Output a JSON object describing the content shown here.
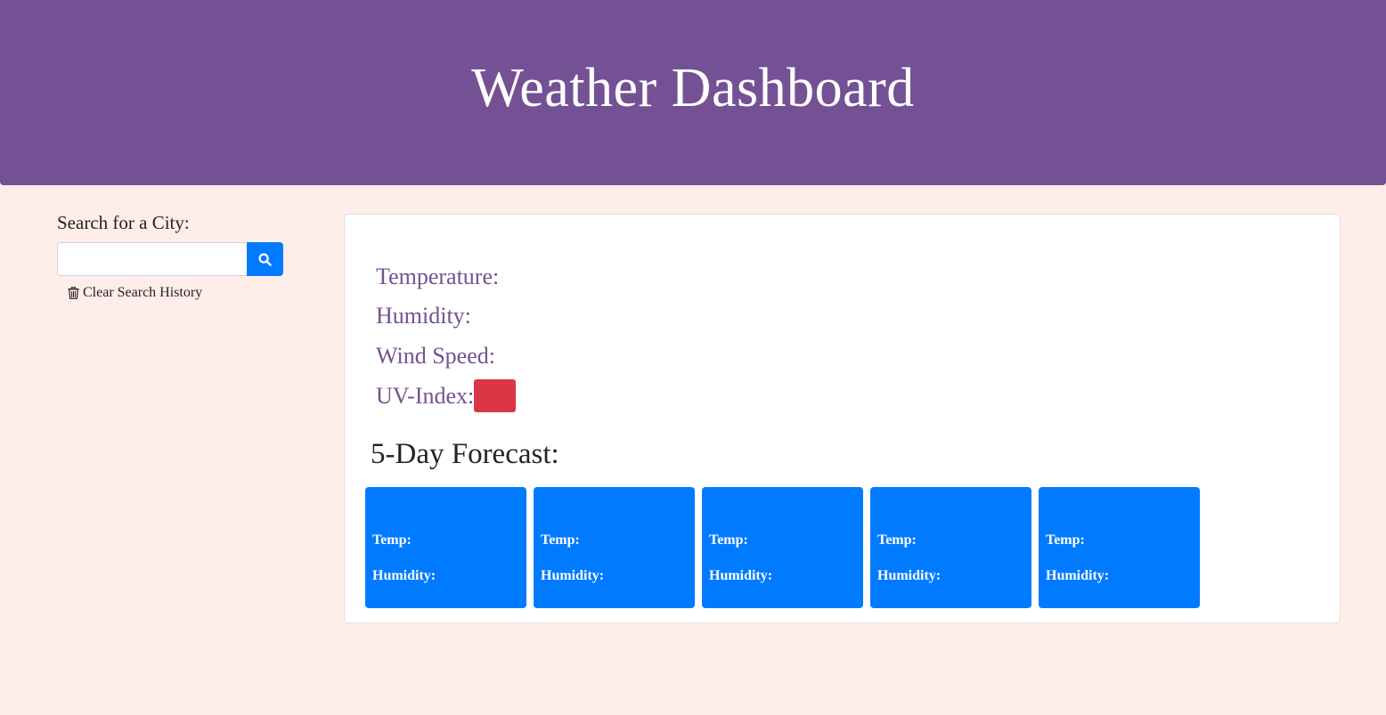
{
  "header": {
    "title": "Weather Dashboard"
  },
  "search": {
    "label": "Search for a City:",
    "value": "",
    "placeholder": "",
    "clear_label": "Clear Search History"
  },
  "current": {
    "temperature_label": "Temperature:",
    "humidity_label": "Humidity:",
    "wind_label": "Wind Speed:",
    "uv_label": "UV-Index:",
    "uv_color": "#dc3545"
  },
  "forecast": {
    "title": "5-Day Forecast:",
    "days": [
      {
        "temp_label": "Temp:",
        "humidity_label": "Humidity:"
      },
      {
        "temp_label": "Temp:",
        "humidity_label": "Humidity:"
      },
      {
        "temp_label": "Temp:",
        "humidity_label": "Humidity:"
      },
      {
        "temp_label": "Temp:",
        "humidity_label": "Humidity:"
      },
      {
        "temp_label": "Temp:",
        "humidity_label": "Humidity:"
      }
    ]
  },
  "colors": {
    "header": "#745194",
    "accent": "#007bff",
    "background": "#ffedea"
  },
  "icons": {
    "search": "search-icon",
    "clear": "trash-icon"
  }
}
